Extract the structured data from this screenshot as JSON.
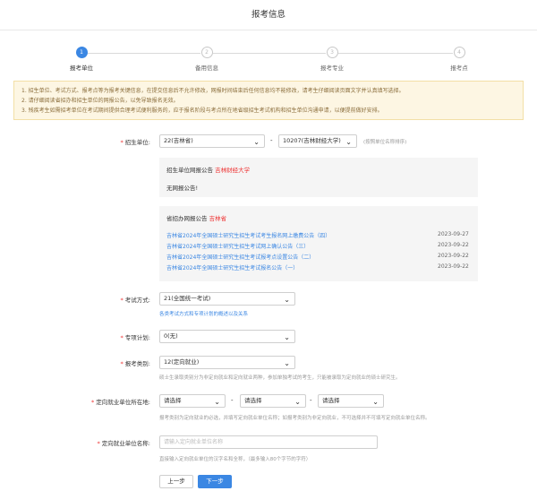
{
  "page": {
    "title": "报考信息"
  },
  "steps": [
    {
      "num": "1",
      "label": "报考单位"
    },
    {
      "num": "2",
      "label": "备用信息"
    },
    {
      "num": "3",
      "label": "报考专业"
    },
    {
      "num": "4",
      "label": "报考点"
    }
  ],
  "notice": [
    "1. 招生单位、考试方式、报考点等为报考关键信息，在提交信息后不允许修改，网报时间结束后任何信息均不能修改，请考生仔细阅读页面文字并认真填写选择。",
    "2. 请仔细阅读省招办和招生单位的网报公告，以免导致报名无效。",
    "3. 残疾考生如需招考单位在考试期间提供合理考试便利服务的，应于报名阶段与考点所在地省级招生考试机构和招生单位沟通申请，以便提前做好安排。"
  ],
  "school": {
    "label": "招生单位:",
    "province": "22(吉林省)",
    "unit": "10207(吉林财经大学)",
    "hint": "(按照单位名称排序)"
  },
  "unit_panel": {
    "title": "招生单位网报公告",
    "name": "吉林财经大学",
    "empty": "无网报公告!"
  },
  "province_panel": {
    "title": "省招办网报公告",
    "name": "吉林省",
    "items": [
      {
        "text": "吉林省2024年全国硕士研究生招生考试考生报名网上缴费公告（四）",
        "date": "2023-09-27"
      },
      {
        "text": "吉林省2024年全国硕士研究生招生考试网上确认公告（三）",
        "date": "2023-09-22"
      },
      {
        "text": "吉林省2024年全国硕士研究生招生考试报考点设置公告（二）",
        "date": "2023-09-22"
      },
      {
        "text": "吉林省2024年全国硕士研究生招生考试报名公告（一）",
        "date": "2023-09-22"
      }
    ]
  },
  "exam_mode": {
    "label": "考试方式:",
    "value": "21(全国统一考试)",
    "link": "各类考试方式和专项计划的概述以及关系"
  },
  "special_plan": {
    "label": "专项计划:",
    "value": "0(无)"
  },
  "category": {
    "label": "报考类别:",
    "value": "12(定向就业)",
    "hint": "硕士生录取类别分为非定向就业和定向就业两种，参加单独考试的考生，只能被录取为定向就业的硕士研究生。"
  },
  "location": {
    "label": "定向就业单位所在地:",
    "opt1": "请选择",
    "opt2": "请选择",
    "opt3": "请选择",
    "hint": "报考类别为定向就业的必选，并填写定向就业单位名称；如报考类别为非定向就业，不可选择并不可填写定向就业单位名称。"
  },
  "employer": {
    "label": "定向就业单位名称:",
    "placeholder": "请输入定向就业单位名称",
    "hint": "直接输入定向就业单位的汉字名和全称，（最多输入80个字节的字符）"
  },
  "buttons": {
    "prev": "上一步",
    "next": "下一步"
  },
  "colors": {
    "accent": "#3b87e3",
    "required": "#e33333",
    "notice_bg": "#fdf6e3"
  }
}
